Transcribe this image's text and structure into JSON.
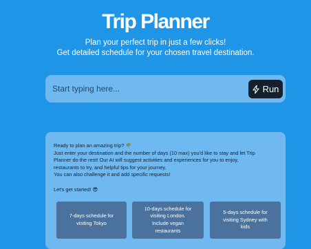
{
  "app": {
    "title": "Trip Planner",
    "subtitle_line1": "Plan your perfect trip in just a few clicks!",
    "subtitle_line2": "Get detailed schedule for your chosen travel destination."
  },
  "search": {
    "placeholder": "Start typing here...",
    "value": "",
    "run_label": "Run",
    "run_icon": "lightning-bolt-icon"
  },
  "intro": {
    "line1": "Ready to plan an amazing trip? 🌴",
    "line2": "Just enter your destination and the number of days (10 max) you'd like to stay and let Trip",
    "line3": "Planner do the rest! Our AI will suggest activities and experiences for you to enjoy,",
    "line4": "restaurants to try, and helpful tips for your journey.",
    "line5": "You can also challenge it and add specific requests!",
    "line6": "Let's get started! 😎"
  },
  "suggestions": [
    {
      "line1": "7-days schedule for",
      "line2": "visiting Tokyo",
      "line3": "",
      "line4": ""
    },
    {
      "line1": "10-days schedule for",
      "line2": "visiting London.",
      "line3": "Include vegan",
      "line4": "restaurants"
    },
    {
      "line1": "5-days schedule for",
      "line2": "visiting Sydney with",
      "line3": "kids",
      "line4": ""
    }
  ],
  "colors": {
    "background": "#1f95e8",
    "panel": "#6fb9f0",
    "run_button": "#14202e",
    "suggestion_card": "#4a729c"
  }
}
